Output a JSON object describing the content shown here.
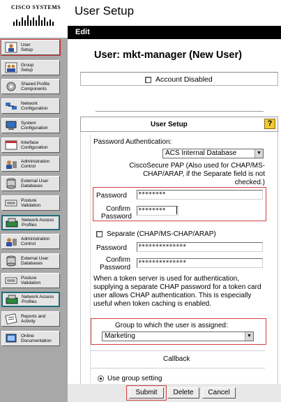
{
  "brand": {
    "name": "Cisco Systems"
  },
  "nav": {
    "items": [
      {
        "label": "User\nSetup",
        "icon": "user-icon"
      },
      {
        "label": "Group\nSetup",
        "icon": "group-icon"
      },
      {
        "label": "Shared Profile\nComponents",
        "icon": "components-icon"
      },
      {
        "label": "Network\nConfiguration",
        "icon": "network-icon"
      },
      {
        "label": "System\nConfiguration",
        "icon": "system-icon"
      },
      {
        "label": "Interface\nConfiguration",
        "icon": "interface-icon"
      },
      {
        "label": "Administration\nControl",
        "icon": "admin-icon"
      },
      {
        "label": "External User\nDatabases",
        "icon": "database-icon"
      },
      {
        "label": "Posture\nValidation",
        "icon": "posture-icon"
      },
      {
        "label": "Network Access\nProfiles",
        "icon": "access-profile-icon"
      },
      {
        "label": "Administration\nControl",
        "icon": "admin-icon"
      },
      {
        "label": "External User\nDatabases",
        "icon": "database-icon"
      },
      {
        "label": "Posture\nValidation",
        "icon": "posture-icon"
      },
      {
        "label": "Network Access\nProfiles",
        "icon": "access-profile-icon"
      },
      {
        "label": "Reports and\nActivity",
        "icon": "reports-icon"
      },
      {
        "label": "Online\nDocumentation",
        "icon": "docs-icon"
      }
    ]
  },
  "header": {
    "title": "User Setup",
    "edit_label": "Edit"
  },
  "user": {
    "heading": "User: mkt-manager (New User)"
  },
  "account": {
    "disabled_label": "Account Disabled"
  },
  "setup": {
    "title": "User Setup",
    "help": "?",
    "password_auth_label": "Password Authentication:",
    "auth_db": "ACS Internal Database",
    "pap_note": "CiscoSecure PAP (Also used for CHAP/MS-CHAP/ARAP, if the Separate field is not checked.)",
    "password_label": "Password",
    "confirm_label": "Confirm\nPassword",
    "pap_password": "********",
    "pap_confirm": "********",
    "separate_label": "Separate (CHAP/MS-CHAP/ARAP)",
    "chap_password": "**************",
    "chap_confirm": "**************",
    "token_note": "When a token server is used for authentication, supplying a separate CHAP password for a token card user allows CHAP authentication. This is especially useful when token caching is enabled.",
    "group_label": "Group to which the user is assigned:",
    "group_value": "Marketing",
    "callback_label": "Callback",
    "callback_option": "Use group setting"
  },
  "buttons": {
    "submit": "Submit",
    "delete": "Delete",
    "cancel": "Cancel"
  }
}
